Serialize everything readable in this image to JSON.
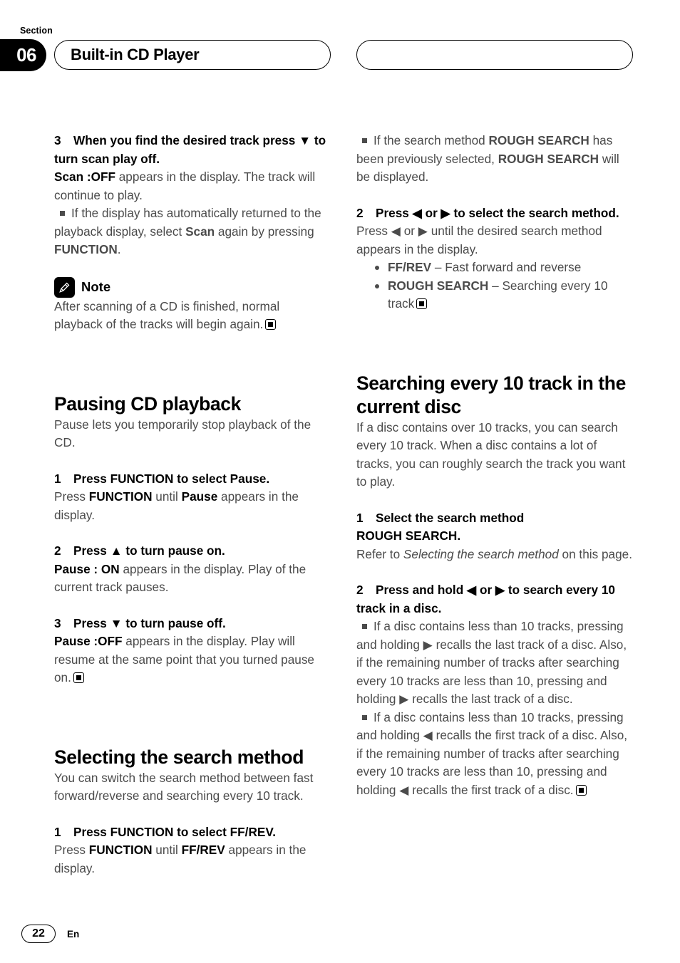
{
  "header": {
    "section_label": "Section",
    "section_number": "06",
    "title": "Built-in CD Player",
    "right_pill_text": ""
  },
  "left_column": {
    "step3_scan": {
      "number": "3",
      "heading": "When you find the desired track press ▼ to turn scan play off.",
      "body_bold_1": "Scan :OFF",
      "body_text_1": " appears in the display. The track will continue to play.",
      "note_bullet_pre": "If the display has automatically returned to the playback display, select ",
      "note_bullet_bold_1": "Scan",
      "note_bullet_mid": " again by pressing ",
      "note_bullet_bold_2": "FUNCTION",
      "note_bullet_end": "."
    },
    "note_block": {
      "icon": "pencil-icon",
      "label": "Note",
      "text": "After scanning of a CD is finished, normal playback of the tracks will begin again."
    },
    "pausing_section": {
      "heading": "Pausing CD playback",
      "intro": "Pause lets you temporarily stop playback of the CD.",
      "step1": {
        "number": "1",
        "heading": "Press FUNCTION to select Pause.",
        "body_pre": "Press ",
        "body_bold_1": "FUNCTION",
        "body_mid": " until ",
        "body_bold_2": "Pause",
        "body_end": " appears in the display."
      },
      "step2": {
        "number": "2",
        "heading": "Press ▲ to turn pause on.",
        "body_bold_1": "Pause : ON",
        "body_end": " appears in the display. Play of the current track pauses."
      },
      "step3": {
        "number": "3",
        "heading": "Press ▼ to turn pause off.",
        "body_bold_1": "Pause :OFF",
        "body_end": " appears in the display. Play will resume at the same point that you turned pause on."
      }
    },
    "selecting_section": {
      "heading": "Selecting the search method",
      "intro": "You can switch the search method between fast forward/reverse and searching every 10 track.",
      "step1": {
        "number": "1",
        "heading": "Press FUNCTION to select FF/REV.",
        "body_pre": "Press ",
        "body_bold_1": "FUNCTION",
        "body_mid": " until ",
        "body_bold_2": "FF/REV",
        "body_end": " appears in the display."
      }
    }
  },
  "right_column": {
    "rough_search_note": {
      "pre": "If the search method ",
      "bold_1": "ROUGH SEARCH",
      "mid": " has been previously selected, ",
      "bold_2": "ROUGH SEARCH",
      "end": " will be displayed."
    },
    "step2_select": {
      "number": "2",
      "heading": "Press ◀ or ▶ to select the search method.",
      "body": "Press ◀ or ▶ until the desired search method appears in the display.",
      "options": [
        {
          "term": "FF/REV",
          "dash": " – ",
          "desc": "Fast forward and reverse",
          "end_marker": false
        },
        {
          "term": "ROUGH SEARCH",
          "dash": " – ",
          "desc": "Searching every 10 track",
          "end_marker": true
        }
      ]
    },
    "searching_section": {
      "heading": "Searching every 10 track in the current disc",
      "intro": "If a disc contains over 10 tracks, you can search every 10 track. When a disc contains a lot of tracks, you can roughly search the track you want to play.",
      "step1": {
        "number": "1",
        "heading_line1": "Select the search method",
        "heading_line2": "ROUGH SEARCH.",
        "body_pre": "Refer to ",
        "body_italic": "Selecting the search method",
        "body_end": " on this page."
      },
      "step2": {
        "number": "2",
        "heading": "Press and hold ◀ or ▶ to search every 10 track in a disc.",
        "bullet_1": "If a disc contains less than 10 tracks, pressing and holding ▶ recalls the last track of a disc. Also, if the remaining number of tracks after searching every 10 tracks are less than 10, pressing and holding ▶ recalls the last track of a disc.",
        "bullet_2": "If a disc contains less than 10 tracks, pressing and holding ◀ recalls the first track of a disc. Also, if the remaining number of tracks after searching every 10 tracks are less than 10, pressing and holding ◀ recalls the first track of a disc."
      }
    }
  },
  "footer": {
    "page_number": "22",
    "language": "En"
  }
}
